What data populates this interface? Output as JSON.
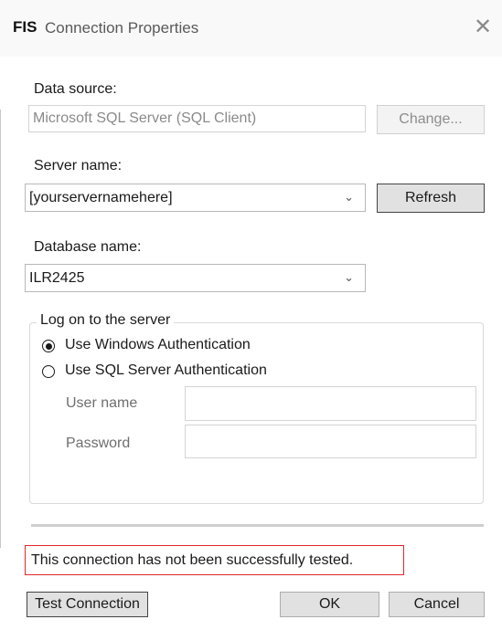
{
  "window": {
    "app_badge": "FIS",
    "title": "Connection Properties",
    "close_icon": "close-icon"
  },
  "data_source": {
    "label": "Data source:",
    "value": "Microsoft SQL Server (SQL Client)",
    "change_button": "Change..."
  },
  "server": {
    "label": "Server name:",
    "value": "[yourservernamehere]",
    "chevron": "⌄",
    "refresh_button": "Refresh"
  },
  "database": {
    "label": "Database name:",
    "value": "ILR2425",
    "chevron": "⌄"
  },
  "logon": {
    "legend": "Log on to the server",
    "options": [
      {
        "label": "Use Windows Authentication",
        "selected": true
      },
      {
        "label": "Use SQL Server Authentication",
        "selected": false
      }
    ],
    "user_name_label": "User name",
    "user_name_value": "",
    "password_label": "Password",
    "password_value": ""
  },
  "status": {
    "message": "This connection has not been successfully tested."
  },
  "buttons": {
    "test": "Test Connection",
    "ok": "OK",
    "cancel": "Cancel"
  },
  "colors": {
    "status_border": "#e0282a",
    "button_face": "#e1e1e1"
  }
}
